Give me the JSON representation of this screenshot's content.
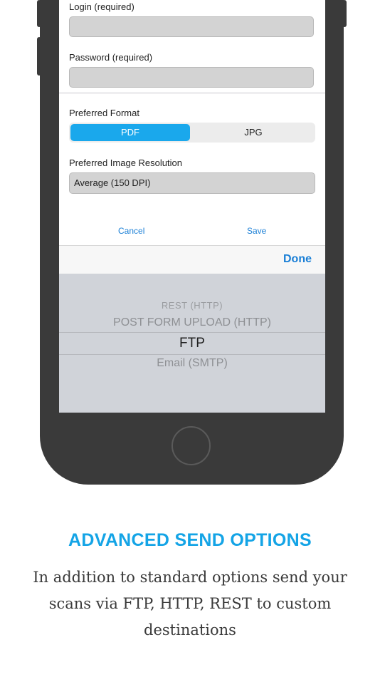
{
  "form": {
    "login_label": "Login (required)",
    "login_value": "",
    "password_label": "Password (required)",
    "password_value": "",
    "format_label": "Preferred Format",
    "format_options": [
      "PDF",
      "JPG"
    ],
    "format_selected": "PDF",
    "resolution_label": "Preferred Image Resolution",
    "resolution_value": "Average (150 DPI)",
    "cancel_label": "Cancel",
    "save_label": "Save"
  },
  "toolbar": {
    "done_label": "Done"
  },
  "picker": {
    "options": [
      "REST (HTTP)",
      "POST FORM UPLOAD (HTTP)",
      "FTP",
      "Email (SMTP)"
    ],
    "selected": "FTP"
  },
  "marketing": {
    "headline": "ADVANCED SEND OPTIONS",
    "description": "In addition to standard options send your scans via FTP, HTTP, REST to custom destinations"
  },
  "colors": {
    "accent": "#14a4e6",
    "segment_active": "#1aa8ec",
    "link": "#1a7fd6",
    "device": "#3a3a3a"
  }
}
